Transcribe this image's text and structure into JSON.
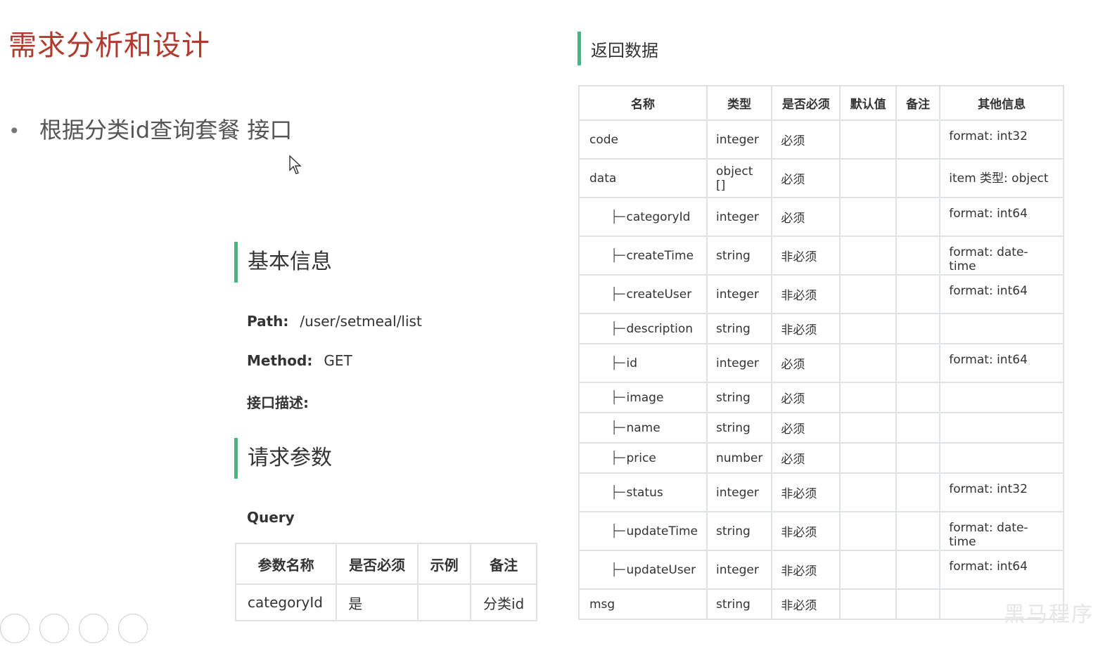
{
  "slide": {
    "title": "需求分析和设计",
    "bullet": "根据分类id查询套餐 接口"
  },
  "basic_info": {
    "heading": "基本信息",
    "path_label": "Path:",
    "path_value": "/user/setmeal/list",
    "method_label": "Method:",
    "method_value": "GET",
    "desc_label": "接口描述:"
  },
  "request": {
    "heading": "请求参数",
    "query_label": "Query",
    "headers": [
      "参数名称",
      "是否必须",
      "示例",
      "备注"
    ],
    "rows": [
      [
        "categoryId",
        "是",
        "",
        "分类id"
      ]
    ]
  },
  "response": {
    "heading": "返回数据",
    "headers": [
      "名称",
      "类型",
      "是否必须",
      "默认值",
      "备注",
      "其他信息"
    ],
    "rows": [
      {
        "name": "code",
        "child": false,
        "type": "integer",
        "required": "必须",
        "default": "",
        "note": "",
        "other": "format: int32"
      },
      {
        "name": "data",
        "child": false,
        "type": "object []",
        "required": "必须",
        "default": "",
        "note": "",
        "other": "item 类型: object"
      },
      {
        "name": "categoryId",
        "child": true,
        "type": "integer",
        "required": "必须",
        "default": "",
        "note": "",
        "other": "format: int64"
      },
      {
        "name": "createTime",
        "child": true,
        "type": "string",
        "required": "非必须",
        "default": "",
        "note": "",
        "other": "format: date-time"
      },
      {
        "name": "createUser",
        "child": true,
        "type": "integer",
        "required": "非必须",
        "default": "",
        "note": "",
        "other": "format: int64"
      },
      {
        "name": "description",
        "child": true,
        "type": "string",
        "required": "非必须",
        "default": "",
        "note": "",
        "other": ""
      },
      {
        "name": "id",
        "child": true,
        "type": "integer",
        "required": "必须",
        "default": "",
        "note": "",
        "other": "format: int64"
      },
      {
        "name": "image",
        "child": true,
        "type": "string",
        "required": "必须",
        "default": "",
        "note": "",
        "other": ""
      },
      {
        "name": "name",
        "child": true,
        "type": "string",
        "required": "必须",
        "default": "",
        "note": "",
        "other": ""
      },
      {
        "name": "price",
        "child": true,
        "type": "number",
        "required": "必须",
        "default": "",
        "note": "",
        "other": ""
      },
      {
        "name": "status",
        "child": true,
        "type": "integer",
        "required": "非必须",
        "default": "",
        "note": "",
        "other": "format: int32"
      },
      {
        "name": "updateTime",
        "child": true,
        "type": "string",
        "required": "非必须",
        "default": "",
        "note": "",
        "other": "format: date-time"
      },
      {
        "name": "updateUser",
        "child": true,
        "type": "integer",
        "required": "非必须",
        "default": "",
        "note": "",
        "other": "format: int64"
      },
      {
        "name": "msg",
        "child": false,
        "type": "string",
        "required": "非必须",
        "default": "",
        "note": "",
        "other": ""
      }
    ]
  },
  "watermark": "黑马程序"
}
